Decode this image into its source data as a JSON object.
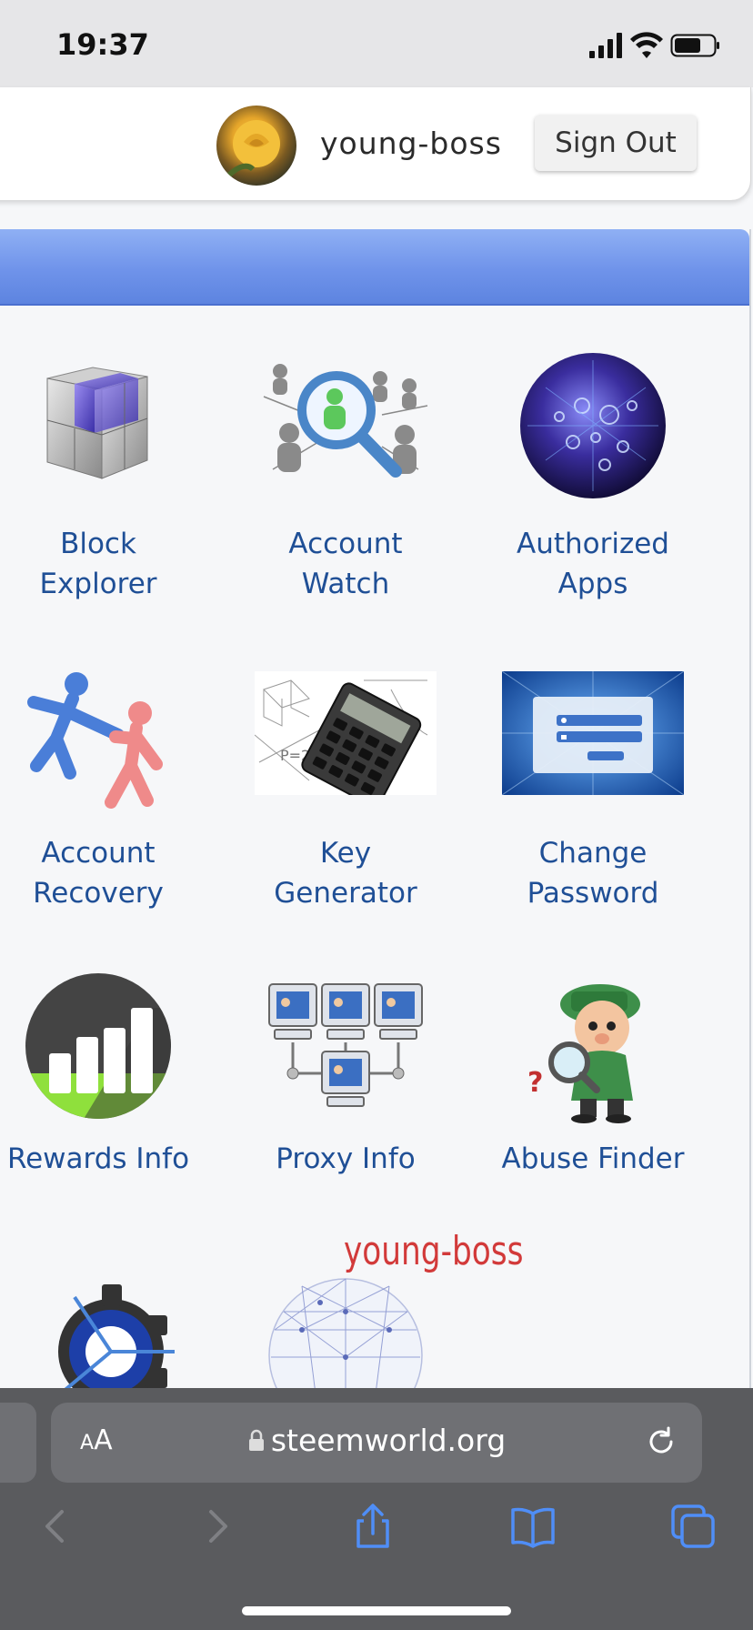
{
  "status_bar": {
    "time": "19:37"
  },
  "header": {
    "username": "young-boss",
    "sign_out_label": "Sign Out"
  },
  "tiles": [
    {
      "line1": "Block",
      "line2": "Explorer"
    },
    {
      "line1": "Account",
      "line2": "Watch"
    },
    {
      "line1": "Authorized",
      "line2": "Apps"
    },
    {
      "line1": "Account",
      "line2": "Recovery"
    },
    {
      "line1": "Key",
      "line2": "Generator"
    },
    {
      "line1": "Change",
      "line2": "Password"
    },
    {
      "line1": "Rewards Info",
      "line2": ""
    },
    {
      "line1": "Proxy Info",
      "line2": ""
    },
    {
      "line1": "Abuse Finder",
      "line2": ""
    }
  ],
  "watermark": "young-boss",
  "browser": {
    "text_size_small": "A",
    "text_size_large": "A",
    "url": "steemworld.org"
  },
  "colors": {
    "link": "#1f4f96",
    "bar_blue": "#6f93ea",
    "watermark_red": "#d23a3a"
  }
}
